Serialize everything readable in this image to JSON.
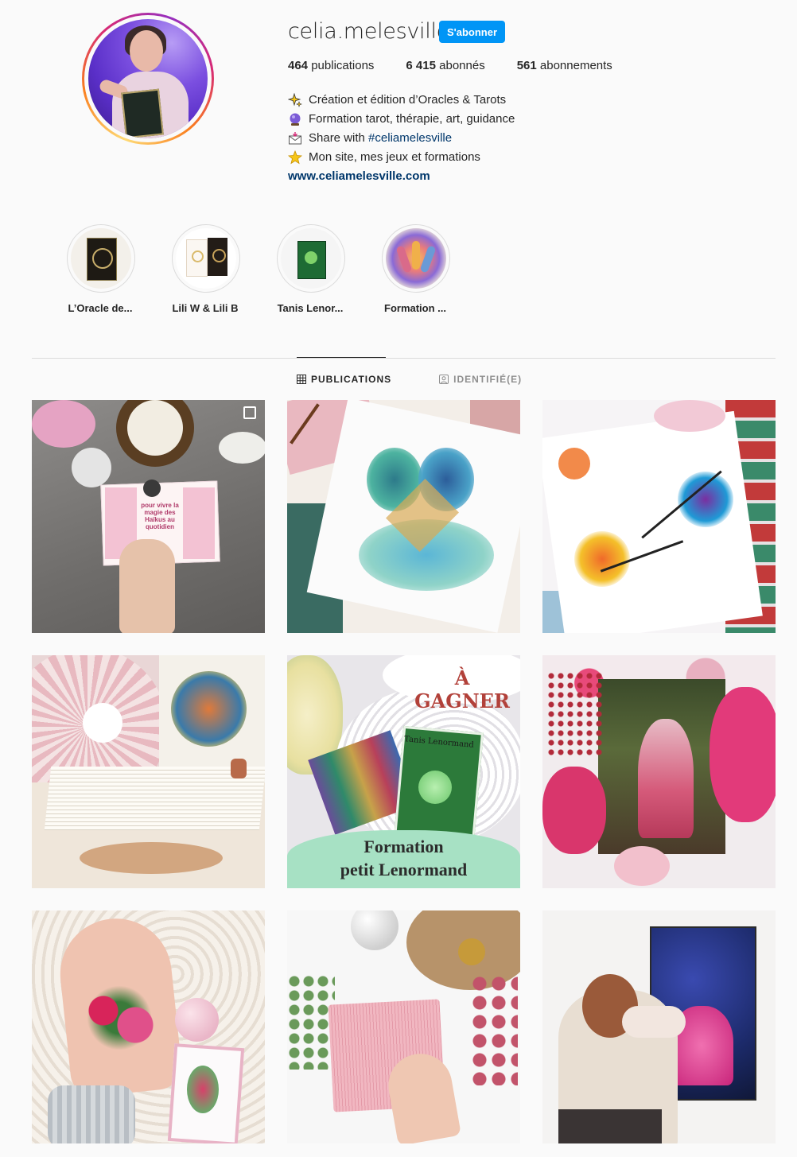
{
  "profile": {
    "username": "celia.melesville",
    "follow_label": "S'abonner",
    "stats": [
      {
        "count": "464",
        "label": "publications"
      },
      {
        "count": "6 415",
        "label": "abonnés"
      },
      {
        "count": "561",
        "label": "abonnements"
      }
    ],
    "bio": {
      "line1": "Création et édition d’Oracles & Tarots",
      "line2": "Formation tarot, thérapie, art, guidance",
      "line3_prefix": "Share with ",
      "line3_hashtag": "#celiamelesville",
      "line4": "Mon site, mes jeux et formations",
      "website": "www.celiamelesville.com",
      "icons": [
        "sparkles-icon",
        "crystal-ball-icon",
        "envelope-icon",
        "star-icon"
      ]
    }
  },
  "highlights": [
    {
      "label": "L’Oracle de..."
    },
    {
      "label": "Lili W & Lili B"
    },
    {
      "label": "Tanis Lenor..."
    },
    {
      "label": "Formation ..."
    }
  ],
  "tabs": [
    {
      "label": "PUBLICATIONS",
      "icon": "grid-icon",
      "active": true
    },
    {
      "label": "IDENTIFIÉ(E)",
      "icon": "tagged-icon",
      "active": false
    }
  ],
  "posts": {
    "post1_box_text": "pour vivre la magie des Haïkus au quotidien",
    "post5_badge": "À GAGNER",
    "post5_deck_title": "Tanis Lenormand",
    "post5_line1": "Formation",
    "post5_line2": "petit Lenormand"
  },
  "colors": {
    "follow_button": "#0095f6",
    "link": "#00376b",
    "background": "#fafafa",
    "border": "#dbdbdb"
  }
}
